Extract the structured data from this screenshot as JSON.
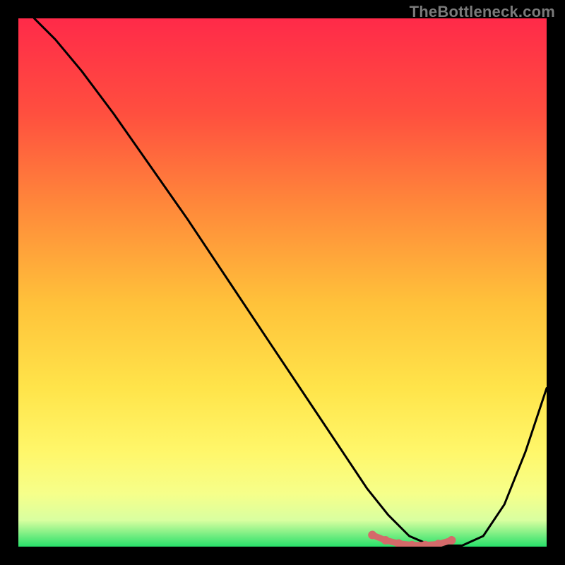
{
  "watermark": "TheBottleneck.com",
  "gradient": {
    "stops": [
      {
        "offset": "0%",
        "color": "#ff2a49"
      },
      {
        "offset": "18%",
        "color": "#ff4f3f"
      },
      {
        "offset": "36%",
        "color": "#ff8a3a"
      },
      {
        "offset": "54%",
        "color": "#ffc23a"
      },
      {
        "offset": "70%",
        "color": "#ffe44a"
      },
      {
        "offset": "82%",
        "color": "#fff76a"
      },
      {
        "offset": "90%",
        "color": "#f6ff8a"
      },
      {
        "offset": "95%",
        "color": "#d9ffa0"
      },
      {
        "offset": "100%",
        "color": "#28e06a"
      }
    ]
  },
  "chart_data": {
    "type": "line",
    "title": "",
    "xlabel": "",
    "ylabel": "",
    "xlim": [
      0,
      100
    ],
    "ylim": [
      0,
      100
    ],
    "series": [
      {
        "name": "curve",
        "x": [
          3,
          7,
          12,
          18,
          25,
          32,
          40,
          48,
          56,
          62,
          66,
          70,
          74,
          78,
          81,
          84,
          88,
          92,
          96,
          100
        ],
        "values": [
          100,
          96,
          90,
          82,
          72,
          62,
          50,
          38,
          26,
          17,
          11,
          6,
          2,
          0.3,
          0.2,
          0.2,
          2,
          8,
          18,
          30
        ]
      },
      {
        "name": "highlight",
        "x": [
          67,
          69.5,
          72,
          74.5,
          77,
          79.5,
          82
        ],
        "values": [
          2.2,
          1.2,
          0.6,
          0.3,
          0.3,
          0.5,
          1.2
        ]
      }
    ],
    "highlight_color": "#d46a6a"
  }
}
